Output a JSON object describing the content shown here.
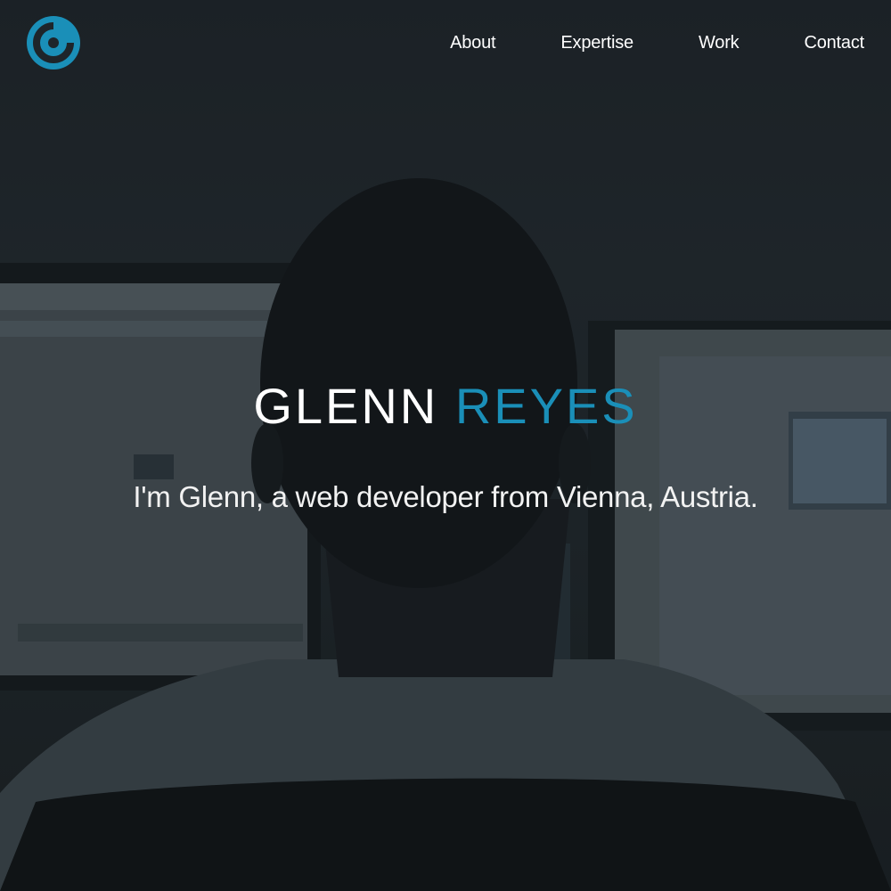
{
  "nav": {
    "logo_icon": "g-logo-icon",
    "links": [
      {
        "label": "About"
      },
      {
        "label": "Expertise"
      },
      {
        "label": "Work"
      },
      {
        "label": "Contact"
      }
    ]
  },
  "hero": {
    "title_first": "GLENN",
    "title_last": "REYES",
    "tagline": "I'm Glenn, a web developer from Vienna, Austria.",
    "background_image": "person-at-computer-photo"
  },
  "colors": {
    "accent": "#1a8fb8",
    "text": "#ffffff",
    "background": "#1e252a"
  }
}
